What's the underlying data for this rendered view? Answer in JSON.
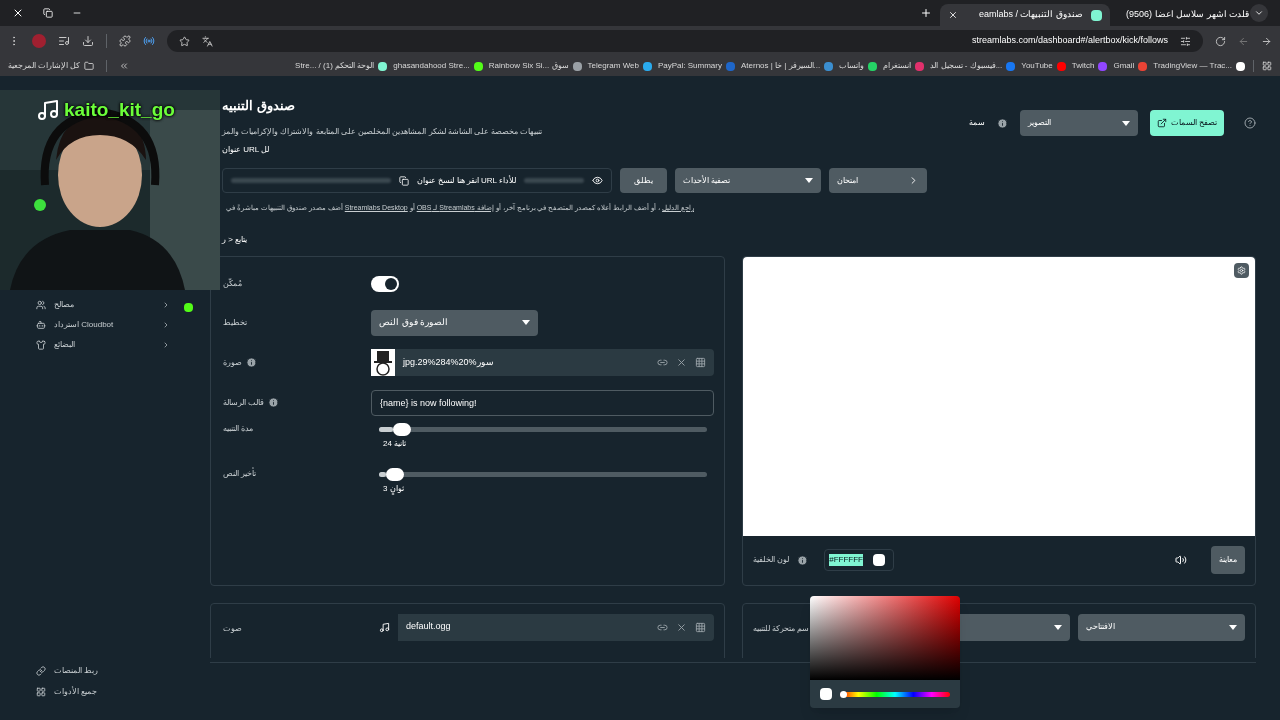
{
  "browser": {
    "tabs": [
      {
        "title": "(9506) قلدت اشهر سلاسل اعضا",
        "selected": false
      },
      {
        "title": "eamlabs / صندوق التنبيهات",
        "selected": true
      }
    ],
    "url": "streamlabs.com/dashboard#/alertbox/kick/follows",
    "all_bookmarks": "كل الإشارات المرجعية",
    "bookmarks": [
      {
        "title": "TradingView — Trac...",
        "color": "#ffffff"
      },
      {
        "title": "Gmail",
        "color": "#ea4335"
      },
      {
        "title": "Twitch",
        "color": "#9146ff"
      },
      {
        "title": "YouTube",
        "color": "#ff0000"
      },
      {
        "title": "فيسبوك - تسجيل الد...",
        "color": "#1877f2"
      },
      {
        "title": "انستغرام",
        "color": "#e1306c"
      },
      {
        "title": "واتساب",
        "color": "#25d366"
      },
      {
        "title": "Aternos | السيرفر | خا...",
        "color": "#3b8fd1"
      },
      {
        "title": "PayPal: Summary",
        "color": "#1e66c9"
      },
      {
        "title": "Telegram Web",
        "color": "#2aabee"
      },
      {
        "title": "Rainbow Six Si... سوق",
        "color": "#9aa0a6"
      },
      {
        "title": "ghasandahood Stre...",
        "color": "#53fc18"
      },
      {
        "title": "Stre... / الوحة التحكم (1)",
        "color": "#80f5d2"
      }
    ]
  },
  "overlay": {
    "handle": "kaito_kit_go"
  },
  "sidebar": {
    "items": [
      {
        "label": "مصالح"
      },
      {
        "label": "استرداد Cloudbot"
      },
      {
        "label": "البضائع"
      }
    ],
    "bottom_items": [
      {
        "label": "ربط المنصات"
      },
      {
        "label": "جميع الأدوات"
      }
    ]
  },
  "header": {
    "title": "صندوق التنبيه",
    "subtitle": "تنبيهات مخصصة على الشاشة لشكر المشاهدين المخلصين على المتابعة والاشتراك والإكراميات والمز",
    "theme_label": "سمة",
    "theme_value": "التصوير",
    "browse_button": "تصفح السمات"
  },
  "url_section": {
    "label": "عنوان URL لل",
    "copy_text": "انقر هنا لنسخ عنوان URL للأداء",
    "launch_button": "يطلق",
    "filter_select": "تصفية الأحداث",
    "test_button": "امتحان",
    "help_parts": [
      {
        "text": "راجع الدليل",
        "link": true
      },
      {
        "text": " ، أو أضف الرابط أعلاه كمصدر المتصفح في برنامج آخر، أو ",
        "link": false
      },
      {
        "text": "إضافة Streamlabs لـ OBS",
        "link": true
      },
      {
        "text": " أو ",
        "link": false
      },
      {
        "text": "Streamlabs Desktop",
        "link": true
      },
      {
        "text": " أضف مصدر صندوق التنبيهات مباشرةً في",
        "link": false
      }
    ]
  },
  "breadcrumb": "يتابع < ر",
  "settings": {
    "rows": [
      {
        "kind": "toggle",
        "label": "مُمكّن",
        "on": true
      },
      {
        "kind": "select",
        "label": "تخطيط",
        "value": "الصورة فوق النص"
      },
      {
        "kind": "file",
        "label": "صورة",
        "info": true,
        "value": "jpg.29%284%20%سور"
      },
      {
        "kind": "text",
        "label": "قالب الرسالة",
        "info": true,
        "value": "{name} is now following!"
      },
      {
        "kind": "slider",
        "label": "مدة التنبيه",
        "level": 0.07,
        "reading": "24 ثانية"
      },
      {
        "kind": "slider",
        "label": "تأخير النص",
        "level": 0.05,
        "reading": "3 ثوانٍ"
      }
    ]
  },
  "preview": {
    "background_label": "لون الخلفية",
    "background_value": "#FFFFFF",
    "color": "#ffffff",
    "preview_button": "معاينة"
  },
  "color_picker": {
    "level": 0
  },
  "sound": {
    "label": "صوت",
    "value": "default.ogg"
  },
  "animation": {
    "label": "سم متحركة للتنبيه",
    "select_value": "الافتتاحي"
  }
}
